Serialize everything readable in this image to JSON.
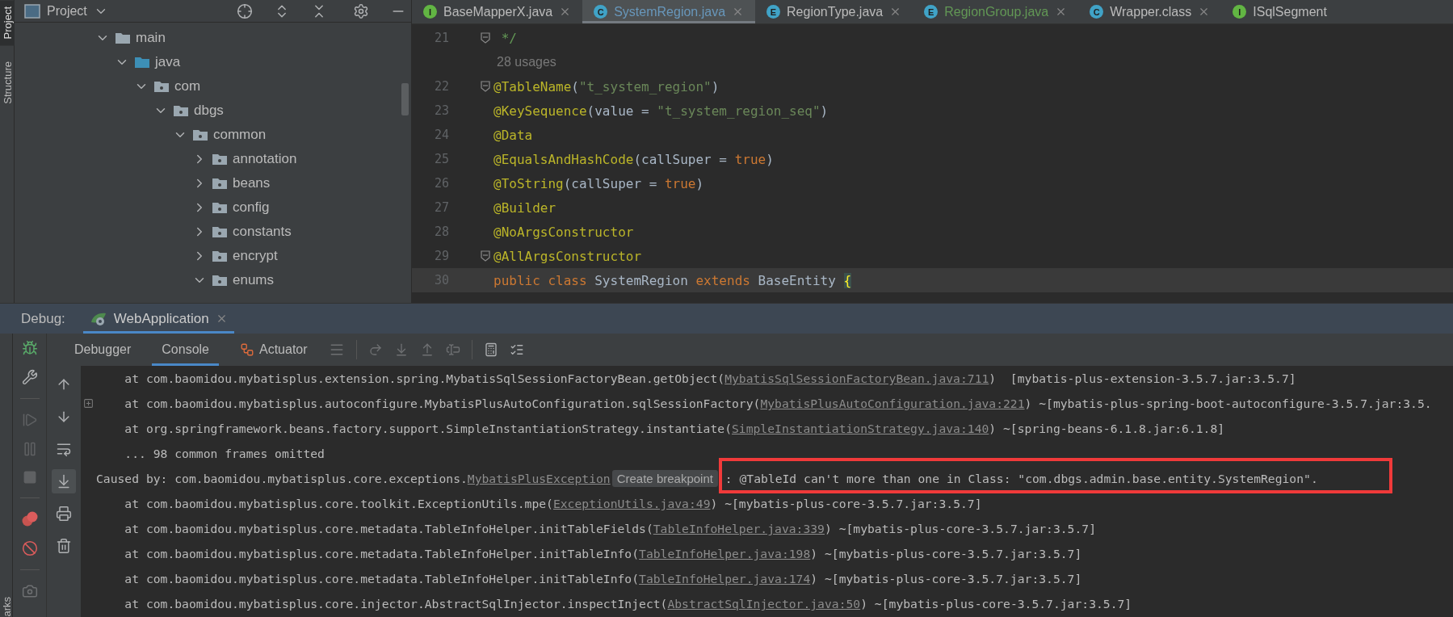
{
  "tool_strip": [
    {
      "label": "Project",
      "selected": true
    },
    {
      "label": "Structure",
      "selected": false
    }
  ],
  "bottom_strip": {
    "label": "arks"
  },
  "project": {
    "title": "Project",
    "tree": [
      {
        "label": "main",
        "kind": "folder",
        "expanded": true,
        "children": [
          {
            "label": "java",
            "kind": "source_root",
            "expanded": true,
            "children": [
              {
                "label": "com",
                "kind": "package",
                "expanded": true,
                "children": [
                  {
                    "label": "dbgs",
                    "kind": "package",
                    "expanded": true,
                    "children": [
                      {
                        "label": "common",
                        "kind": "package",
                        "expanded": true,
                        "children": [
                          {
                            "label": "annotation",
                            "kind": "package",
                            "expanded": false
                          },
                          {
                            "label": "beans",
                            "kind": "package",
                            "expanded": false
                          },
                          {
                            "label": "config",
                            "kind": "package",
                            "expanded": false
                          },
                          {
                            "label": "constants",
                            "kind": "package",
                            "expanded": false
                          },
                          {
                            "label": "encrypt",
                            "kind": "package",
                            "expanded": false
                          },
                          {
                            "label": "enums",
                            "kind": "package",
                            "expanded": true
                          }
                        ]
                      }
                    ]
                  }
                ]
              }
            ]
          }
        ]
      }
    ]
  },
  "editor": {
    "tabs": [
      {
        "label": "BaseMapperX.java",
        "badge": "I",
        "kind": "interface",
        "selected": false,
        "closable": true,
        "color": "#bbbbbb"
      },
      {
        "label": "SystemRegion.java",
        "badge": "C",
        "kind": "class",
        "selected": true,
        "closable": true,
        "color": "#6897bb"
      },
      {
        "label": "RegionType.java",
        "badge": "E",
        "kind": "enum",
        "selected": false,
        "closable": true,
        "color": "#bbbbbb"
      },
      {
        "label": "RegionGroup.java",
        "badge": "E",
        "kind": "enum",
        "selected": false,
        "closable": true,
        "color": "#629755"
      },
      {
        "label": "Wrapper.class",
        "badge": "C",
        "kind": "class",
        "selected": false,
        "closable": true,
        "color": "#bbbbbb"
      },
      {
        "label": "ISqlSegment",
        "badge": "I",
        "kind": "interface",
        "selected": false,
        "closable": false,
        "color": "#bbbbbb"
      }
    ],
    "lines": [
      {
        "kind": "code",
        "number": "21",
        "fold": true,
        "current": false,
        "tokens": [
          {
            "kind": "comment",
            "text": " */"
          }
        ]
      },
      {
        "kind": "hint",
        "text": "28 usages"
      },
      {
        "kind": "code",
        "number": "22",
        "fold": true,
        "current": false,
        "tokens": [
          {
            "kind": "annotation",
            "text": "@TableName"
          },
          {
            "kind": "plain",
            "text": "("
          },
          {
            "kind": "string",
            "text": "\"t_system_region\""
          },
          {
            "kind": "plain",
            "text": ")"
          }
        ]
      },
      {
        "kind": "code",
        "number": "23",
        "fold": false,
        "current": false,
        "tokens": [
          {
            "kind": "annotation",
            "text": "@KeySequence"
          },
          {
            "kind": "plain",
            "text": "(value = "
          },
          {
            "kind": "string",
            "text": "\"t_system_region_seq\""
          },
          {
            "kind": "plain",
            "text": ")"
          }
        ]
      },
      {
        "kind": "code",
        "number": "24",
        "fold": false,
        "current": false,
        "tokens": [
          {
            "kind": "annotation",
            "text": "@Data"
          }
        ]
      },
      {
        "kind": "code",
        "number": "25",
        "fold": false,
        "current": false,
        "tokens": [
          {
            "kind": "annotation",
            "text": "@EqualsAndHashCode"
          },
          {
            "kind": "plain",
            "text": "(callSuper = "
          },
          {
            "kind": "keyword",
            "text": "true"
          },
          {
            "kind": "plain",
            "text": ")"
          }
        ]
      },
      {
        "kind": "code",
        "number": "26",
        "fold": false,
        "current": false,
        "tokens": [
          {
            "kind": "annotation",
            "text": "@ToString"
          },
          {
            "kind": "plain",
            "text": "(callSuper = "
          },
          {
            "kind": "keyword",
            "text": "true"
          },
          {
            "kind": "plain",
            "text": ")"
          }
        ]
      },
      {
        "kind": "code",
        "number": "27",
        "fold": false,
        "current": false,
        "tokens": [
          {
            "kind": "annotation",
            "text": "@Builder"
          }
        ]
      },
      {
        "kind": "code",
        "number": "28",
        "fold": false,
        "current": false,
        "tokens": [
          {
            "kind": "annotation",
            "text": "@NoArgsConstructor"
          }
        ]
      },
      {
        "kind": "code",
        "number": "29",
        "fold": true,
        "current": false,
        "tokens": [
          {
            "kind": "annotation",
            "text": "@AllArgsConstructor"
          }
        ]
      },
      {
        "kind": "code",
        "number": "30",
        "fold": false,
        "current": true,
        "tokens": [
          {
            "kind": "keyword",
            "text": "public class "
          },
          {
            "kind": "plain",
            "text": "SystemRegion "
          },
          {
            "kind": "keyword",
            "text": "extends "
          },
          {
            "kind": "plain",
            "text": "BaseEntity "
          },
          {
            "kind": "brace_match",
            "text": "{"
          }
        ]
      }
    ]
  },
  "debug": {
    "label": "Debug:",
    "sessions": [
      {
        "label": "WebApplication",
        "selected": true
      }
    ],
    "tabs": [
      {
        "label": "Debugger",
        "selected": false
      },
      {
        "label": "Console",
        "selected": true
      },
      {
        "label": "Actuator",
        "selected": false
      }
    ],
    "console": [
      {
        "foldable": false,
        "highlighted": false,
        "segments": [
          {
            "kind": "text",
            "text": "    at com.baomidou.mybatisplus.extension.spring.MybatisSqlSessionFactoryBean.getObject("
          },
          {
            "kind": "link",
            "text": "MybatisSqlSessionFactoryBean.java:711"
          },
          {
            "kind": "text",
            "text": ")  [mybatis-plus-extension-3.5.7.jar:3.5.7]"
          }
        ]
      },
      {
        "foldable": true,
        "highlighted": false,
        "segments": [
          {
            "kind": "text",
            "text": "    at com.baomidou.mybatisplus.autoconfigure.MybatisPlusAutoConfiguration.sqlSessionFactory("
          },
          {
            "kind": "link",
            "text": "MybatisPlusAutoConfiguration.java:221"
          },
          {
            "kind": "text",
            "text": ") ~[mybatis-plus-spring-boot-autoconfigure-3.5.7.jar:3.5."
          }
        ]
      },
      {
        "foldable": false,
        "highlighted": false,
        "segments": [
          {
            "kind": "text",
            "text": "    at org.springframework.beans.factory.support.SimpleInstantiationStrategy.instantiate("
          },
          {
            "kind": "link",
            "text": "SimpleInstantiationStrategy.java:140"
          },
          {
            "kind": "text",
            "text": ") ~[spring-beans-6.1.8.jar:6.1.8]"
          }
        ]
      },
      {
        "foldable": false,
        "highlighted": false,
        "segments": [
          {
            "kind": "text",
            "text": "    ... 98 common frames omitted"
          }
        ]
      },
      {
        "foldable": false,
        "highlighted": true,
        "segments": [
          {
            "kind": "text",
            "text": "Caused by: com.baomidou.mybatisplus.core.exceptions."
          },
          {
            "kind": "link",
            "text": "MybatisPlusException"
          },
          {
            "kind": "tooltip",
            "text": "Create breakpoint"
          },
          {
            "kind": "text",
            "text": " : @TableId can't more than one in Class: \"com.dbgs.admin.base.entity.SystemRegion\"."
          }
        ]
      },
      {
        "foldable": false,
        "highlighted": false,
        "segments": [
          {
            "kind": "text",
            "text": "    at com.baomidou.mybatisplus.core.toolkit.ExceptionUtils.mpe("
          },
          {
            "kind": "link",
            "text": "ExceptionUtils.java:49"
          },
          {
            "kind": "text",
            "text": ") ~[mybatis-plus-core-3.5.7.jar:3.5.7]"
          }
        ]
      },
      {
        "foldable": false,
        "highlighted": false,
        "segments": [
          {
            "kind": "text",
            "text": "    at com.baomidou.mybatisplus.core.metadata.TableInfoHelper.initTableFields("
          },
          {
            "kind": "link",
            "text": "TableInfoHelper.java:339"
          },
          {
            "kind": "text",
            "text": ") ~[mybatis-plus-core-3.5.7.jar:3.5.7]"
          }
        ]
      },
      {
        "foldable": false,
        "highlighted": false,
        "segments": [
          {
            "kind": "text",
            "text": "    at com.baomidou.mybatisplus.core.metadata.TableInfoHelper.initTableInfo("
          },
          {
            "kind": "link",
            "text": "TableInfoHelper.java:198"
          },
          {
            "kind": "text",
            "text": ") ~[mybatis-plus-core-3.5.7.jar:3.5.7]"
          }
        ]
      },
      {
        "foldable": false,
        "highlighted": false,
        "segments": [
          {
            "kind": "text",
            "text": "    at com.baomidou.mybatisplus.core.metadata.TableInfoHelper.initTableInfo("
          },
          {
            "kind": "link",
            "text": "TableInfoHelper.java:174"
          },
          {
            "kind": "text",
            "text": ") ~[mybatis-plus-core-3.5.7.jar:3.5.7]"
          }
        ]
      },
      {
        "foldable": false,
        "highlighted": false,
        "segments": [
          {
            "kind": "text",
            "text": "    at com.baomidou.mybatisplus.core.injector.AbstractSqlInjector.inspectInject("
          },
          {
            "kind": "link",
            "text": "AbstractSqlInjector.java:50"
          },
          {
            "kind": "text",
            "text": ") ~[mybatis-plus-core-3.5.7.jar:3.5.7]"
          }
        ]
      }
    ]
  }
}
